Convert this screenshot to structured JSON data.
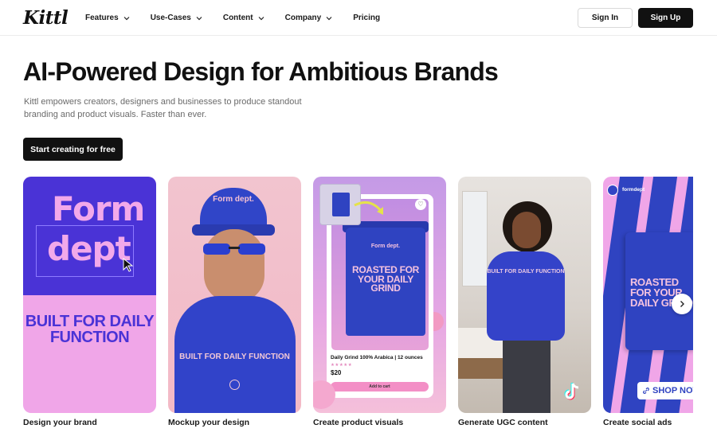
{
  "nav": {
    "logo": "Kittl",
    "items": [
      {
        "label": "Features",
        "has_dropdown": true
      },
      {
        "label": "Use-Cases",
        "has_dropdown": true
      },
      {
        "label": "Content",
        "has_dropdown": true
      },
      {
        "label": "Company",
        "has_dropdown": true
      },
      {
        "label": "Pricing",
        "has_dropdown": false
      }
    ],
    "signin_label": "Sign In",
    "signup_label": "Sign Up"
  },
  "hero": {
    "title": "AI-Powered Design for Ambitious Brands",
    "subtitle": "Kittl empowers creators, designers and businesses to produce standout branding and product visuals. Faster than ever.",
    "cta_label": "Start creating for free"
  },
  "cards": [
    {
      "caption": "Design your brand",
      "art": {
        "line1": "Form",
        "line2": "dept",
        "tagline": "BUILT FOR DAILY FUNCTION"
      }
    },
    {
      "caption": "Mockup your design",
      "art": {
        "cap_text": "Form dept.",
        "hoodie_text": "BUILT FOR DAILY FUNCTION"
      }
    },
    {
      "caption": "Create product visuals",
      "art": {
        "bag_brand": "Form dept.",
        "bag_text": "ROASTED FOR YOUR DAILY GRIND",
        "product_title": "Daily Grind 100% Arabica | 12 ounces",
        "rating": "★★★★★",
        "price": "$20",
        "add_to_cart": "Add to cart"
      }
    },
    {
      "caption": "Generate UGC content",
      "art": {
        "sweater_text": "BUILT FOR DAILY FUNCTION"
      }
    },
    {
      "caption": "Create social ads",
      "art": {
        "account": "formdept",
        "bag_text": "ROASTED FOR YOUR DAILY GRIND",
        "shop_label": "SHOP NOW"
      }
    }
  ],
  "colors": {
    "brand_blue": "#2f43c1",
    "brand_pink": "#f0a6e8",
    "primary_button": "#111111"
  },
  "icons": {
    "dropdown": "chevron-down-icon",
    "carousel_next": "chevron-right-icon",
    "cursor": "cursor-icon",
    "heart": "heart-icon",
    "tiktok": "tiktok-icon",
    "link": "link-icon",
    "globe": "globe-icon"
  }
}
